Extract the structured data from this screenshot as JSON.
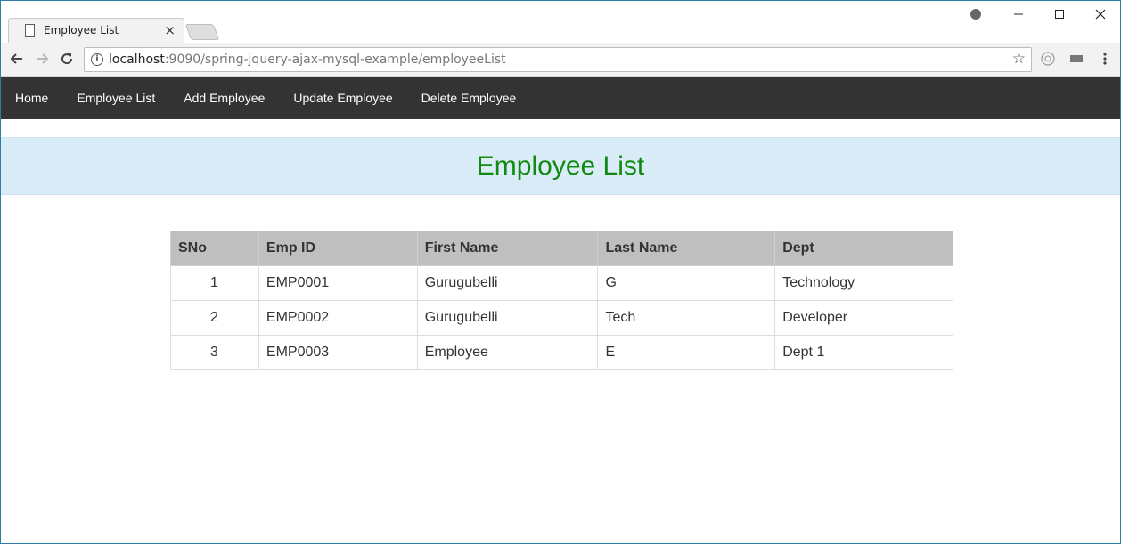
{
  "browser": {
    "tab_title": "Employee List",
    "tab_close": "×",
    "url_host": "localhost",
    "url_path": ":9090/spring-jquery-ajax-mysql-example/employeeList",
    "icons": {
      "back": "back-arrow-icon",
      "forward": "forward-arrow-icon",
      "reload": "reload-icon",
      "info": "info-icon",
      "star": "star-icon",
      "profile": "profile-icon",
      "menu": "menu-dots-icon"
    }
  },
  "navbar": {
    "items": [
      {
        "label": "Home"
      },
      {
        "label": "Employee List"
      },
      {
        "label": "Add Employee"
      },
      {
        "label": "Update Employee"
      },
      {
        "label": "Delete Employee"
      }
    ]
  },
  "header": {
    "title": "Employee List",
    "title_color": "#118a11",
    "background": "#d9ecf7"
  },
  "table": {
    "columns": [
      "SNo",
      "Emp ID",
      "First Name",
      "Last Name",
      "Dept"
    ],
    "rows": [
      {
        "sno": "1",
        "emp_id": "EMP0001",
        "first_name": "Gurugubelli",
        "last_name": "G",
        "dept": "Technology"
      },
      {
        "sno": "2",
        "emp_id": "EMP0002",
        "first_name": "Gurugubelli",
        "last_name": "Tech",
        "dept": "Developer"
      },
      {
        "sno": "3",
        "emp_id": "EMP0003",
        "first_name": "Employee",
        "last_name": "E",
        "dept": "Dept 1"
      }
    ]
  }
}
